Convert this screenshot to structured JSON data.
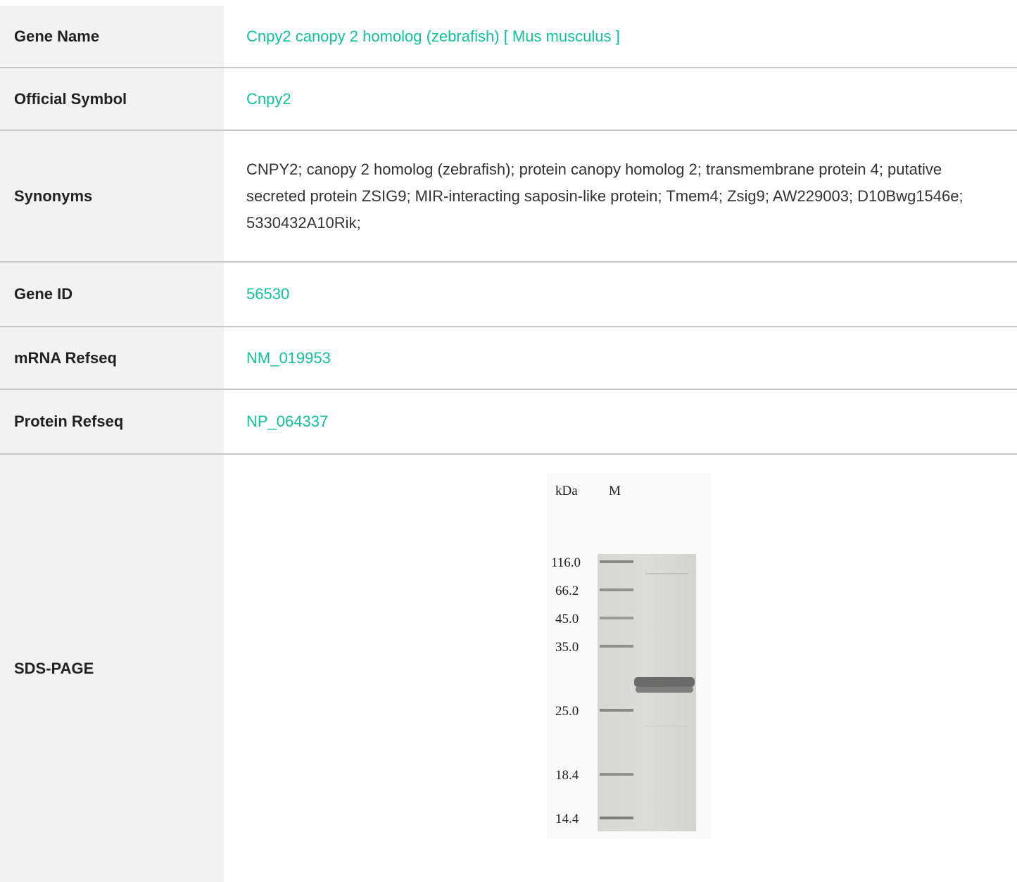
{
  "rows": {
    "gene_name": {
      "label": "Gene Name",
      "value": "Cnpy2 canopy 2 homolog (zebrafish) [ Mus musculus ]"
    },
    "official_symbol": {
      "label": "Official Symbol",
      "value": "Cnpy2"
    },
    "synonyms": {
      "label": "Synonyms",
      "value": "CNPY2; canopy 2 homolog (zebrafish); protein canopy homolog 2; transmembrane protein 4; putative secreted protein ZSIG9; MIR-interacting saposin-like protein; Tmem4; Zsig9; AW229003; D10Bwg1546e; 5330432A10Rik;"
    },
    "gene_id": {
      "label": "Gene ID",
      "value": "56530"
    },
    "mrna_refseq": {
      "label": "mRNA Refseq",
      "value": "NM_019953"
    },
    "protein_refseq": {
      "label": "Protein Refseq",
      "value": "NP_064337"
    },
    "sds_page": {
      "label": "SDS-PAGE",
      "gel": {
        "unit_label": "kDa",
        "marker_lane_label": "M",
        "markers": [
          "116.0",
          "66.2",
          "45.0",
          "35.0",
          "25.0",
          "18.4",
          "14.4"
        ]
      }
    }
  },
  "colors": {
    "link": "#10c39a",
    "label_bg": "#f2f2f2",
    "divider": "#c8c8c8"
  }
}
